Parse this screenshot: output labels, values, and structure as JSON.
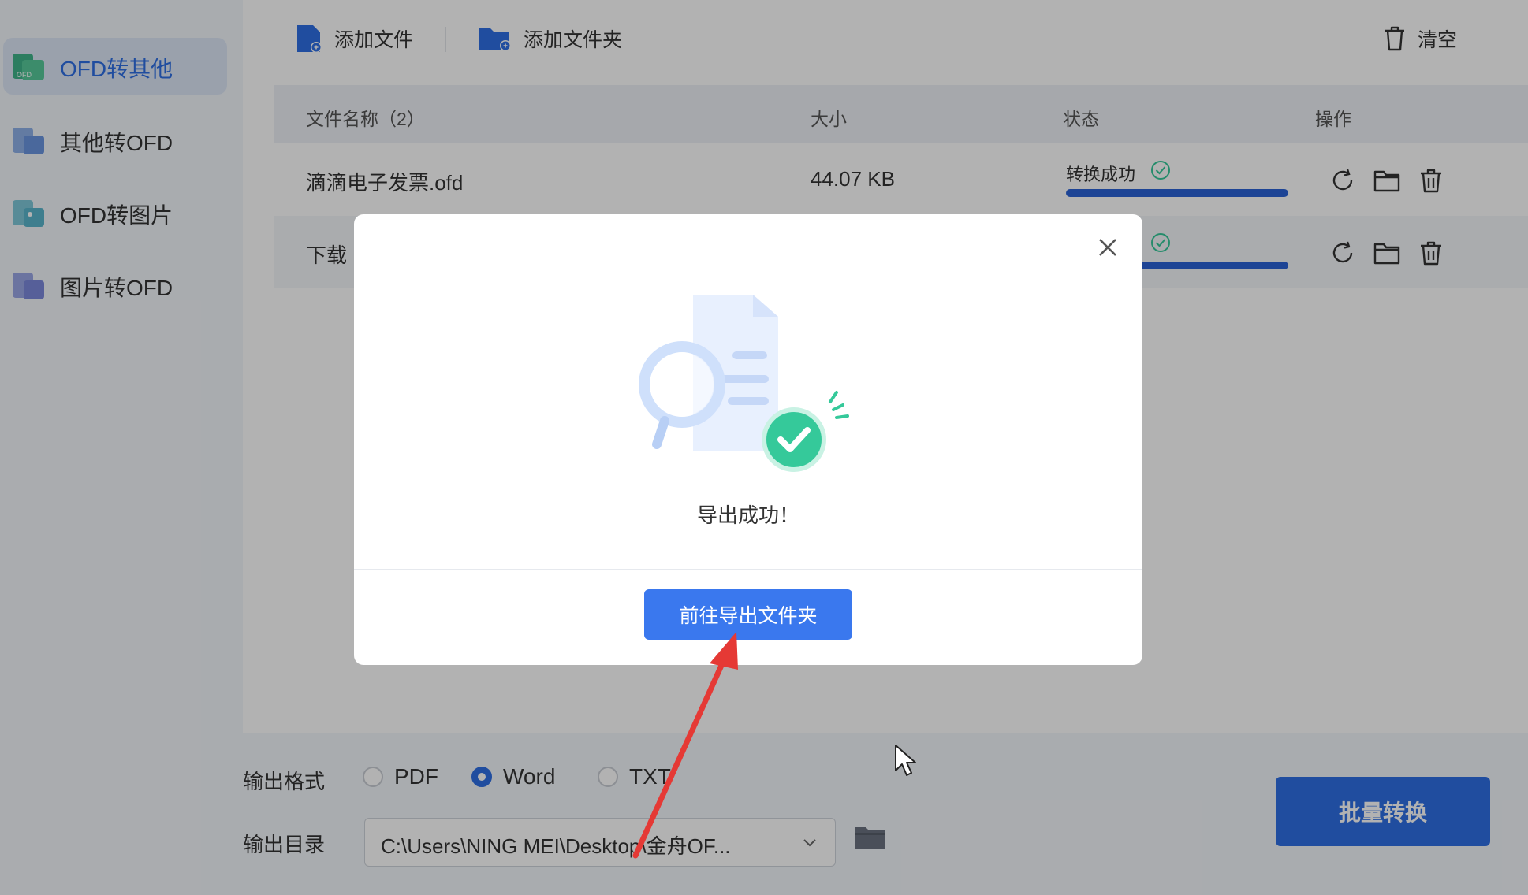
{
  "sidebar": {
    "items": [
      {
        "label": "OFD转其他",
        "icon": "ofd-to-other-icon",
        "active": true
      },
      {
        "label": "其他转OFD",
        "icon": "other-to-ofd-icon",
        "active": false
      },
      {
        "label": "OFD转图片",
        "icon": "ofd-to-image-icon",
        "active": false
      },
      {
        "label": "图片转OFD",
        "icon": "image-to-ofd-icon",
        "active": false
      }
    ]
  },
  "toolbar": {
    "add_file": "添加文件",
    "add_folder": "添加文件夹",
    "clear": "清空"
  },
  "table": {
    "headers": {
      "name": "文件名称（2）",
      "size": "大小",
      "status": "状态",
      "ops": "操作"
    },
    "rows": [
      {
        "name": "滴滴电子发票.ofd",
        "size": "44.07 KB",
        "status": "转换成功",
        "progress": 1.0
      },
      {
        "name": "下载",
        "size": "",
        "status": "",
        "progress": 1.0
      }
    ]
  },
  "bottom": {
    "format_label": "输出格式",
    "formats": [
      "PDF",
      "Word",
      "TXT"
    ],
    "selected_format": "Word",
    "dir_label": "输出目录",
    "dir_value": "C:\\Users\\NING MEI\\Desktop\\金舟OF...",
    "batch_button": "批量转换"
  },
  "modal": {
    "message": "导出成功！",
    "button": "前往导出文件夹"
  },
  "colors": {
    "accent": "#2f6fe4",
    "success": "#35c99a",
    "annotation": "#e53935"
  }
}
